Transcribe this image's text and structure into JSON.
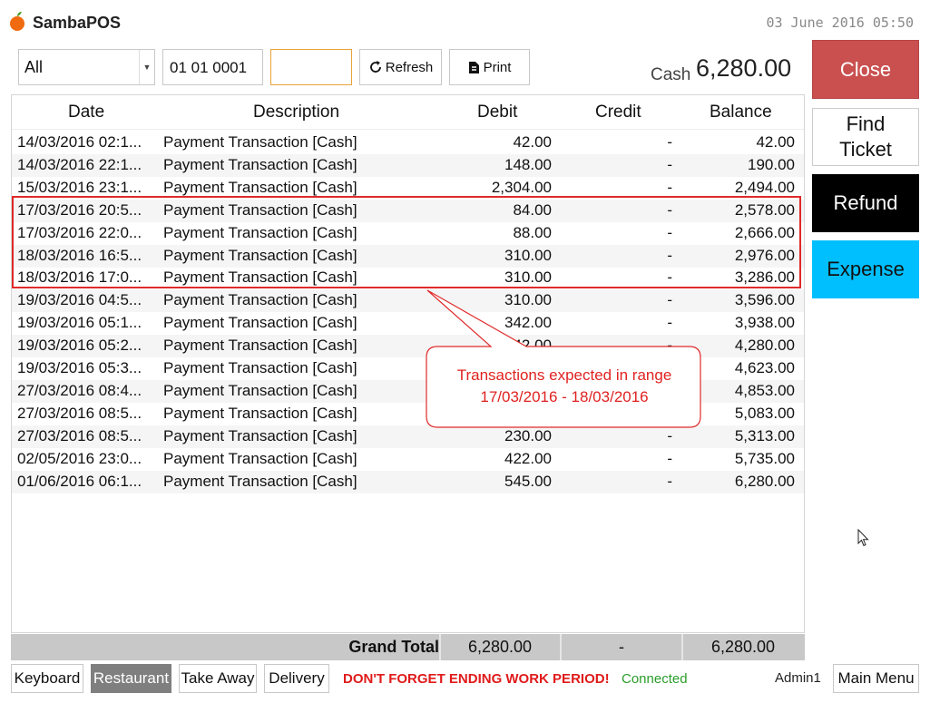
{
  "app": {
    "title": "SambaPOS",
    "clock": "03 June 2016 05:50"
  },
  "toolbar": {
    "account": "All",
    "date_start": "01 01 0001",
    "date_end": "",
    "refresh_label": "Refresh",
    "print_label": "Print",
    "cash_label": "Cash",
    "cash_value": "6,280.00"
  },
  "side": {
    "close": "Close",
    "find_ticket": "Find Ticket",
    "refund": "Refund",
    "expense": "Expense"
  },
  "table": {
    "columns": [
      "Date",
      "Description",
      "Debit",
      "Credit",
      "Balance"
    ],
    "rows": [
      {
        "date": "14/03/2016 02:1...",
        "desc": "Payment Transaction [Cash]",
        "debit": "42.00",
        "credit": "-",
        "balance": "42.00"
      },
      {
        "date": "14/03/2016 22:1...",
        "desc": "Payment Transaction [Cash]",
        "debit": "148.00",
        "credit": "-",
        "balance": "190.00"
      },
      {
        "date": "15/03/2016 23:1...",
        "desc": "Payment Transaction [Cash]",
        "debit": "2,304.00",
        "credit": "-",
        "balance": "2,494.00"
      },
      {
        "date": "17/03/2016 20:5...",
        "desc": "Payment Transaction [Cash]",
        "debit": "84.00",
        "credit": "-",
        "balance": "2,578.00"
      },
      {
        "date": "17/03/2016 22:0...",
        "desc": "Payment Transaction [Cash]",
        "debit": "88.00",
        "credit": "-",
        "balance": "2,666.00"
      },
      {
        "date": "18/03/2016 16:5...",
        "desc": "Payment Transaction [Cash]",
        "debit": "310.00",
        "credit": "-",
        "balance": "2,976.00"
      },
      {
        "date": "18/03/2016 17:0...",
        "desc": "Payment Transaction [Cash]",
        "debit": "310.00",
        "credit": "-",
        "balance": "3,286.00"
      },
      {
        "date": "19/03/2016 04:5...",
        "desc": "Payment Transaction [Cash]",
        "debit": "310.00",
        "credit": "-",
        "balance": "3,596.00"
      },
      {
        "date": "19/03/2016 05:1...",
        "desc": "Payment Transaction [Cash]",
        "debit": "342.00",
        "credit": "-",
        "balance": "3,938.00"
      },
      {
        "date": "19/03/2016 05:2...",
        "desc": "Payment Transaction [Cash]",
        "debit": "342.00",
        "credit": "-",
        "balance": "4,280.00"
      },
      {
        "date": "19/03/2016 05:3...",
        "desc": "Payment Transaction [Cash]",
        "debit": "",
        "credit": "",
        "balance": "4,623.00"
      },
      {
        "date": "27/03/2016 08:4...",
        "desc": "Payment Transaction [Cash]",
        "debit": "",
        "credit": "",
        "balance": "4,853.00"
      },
      {
        "date": "27/03/2016 08:5...",
        "desc": "Payment Transaction [Cash]",
        "debit": "",
        "credit": "",
        "balance": "5,083.00"
      },
      {
        "date": "27/03/2016 08:5...",
        "desc": "Payment Transaction [Cash]",
        "debit": "230.00",
        "credit": "-",
        "balance": "5,313.00"
      },
      {
        "date": "02/05/2016 23:0...",
        "desc": "Payment Transaction [Cash]",
        "debit": "422.00",
        "credit": "-",
        "balance": "5,735.00"
      },
      {
        "date": "01/06/2016 06:1...",
        "desc": "Payment Transaction [Cash]",
        "debit": "545.00",
        "credit": "-",
        "balance": "6,280.00"
      }
    ]
  },
  "totals": {
    "label": "Grand Total",
    "debit": "6,280.00",
    "credit": "-",
    "balance": "6,280.00"
  },
  "callout": {
    "line1": "Transactions expected in range",
    "line2": "17/03/2016 - 18/03/2016"
  },
  "footer": {
    "keyboard": "Keyboard",
    "restaurant": "Restaurant",
    "take_away": "Take Away",
    "delivery": "Delivery",
    "warning": "DON'T FORGET ENDING WORK PERIOD!",
    "status": "Connected",
    "user": "Admin1",
    "main_menu": "Main Menu"
  },
  "colors": {
    "close": "#c9504f",
    "refund": "#000000",
    "expense": "#00bfff",
    "warning": "#e01a1a",
    "connected": "#2a9d2a",
    "annotation": "#e02a2a"
  },
  "icons": {
    "logo": "orange-logo-icon",
    "refresh": "refresh-icon",
    "print": "print-icon",
    "dropdown": "chevron-down-icon",
    "cursor": "mouse-pointer-icon"
  }
}
